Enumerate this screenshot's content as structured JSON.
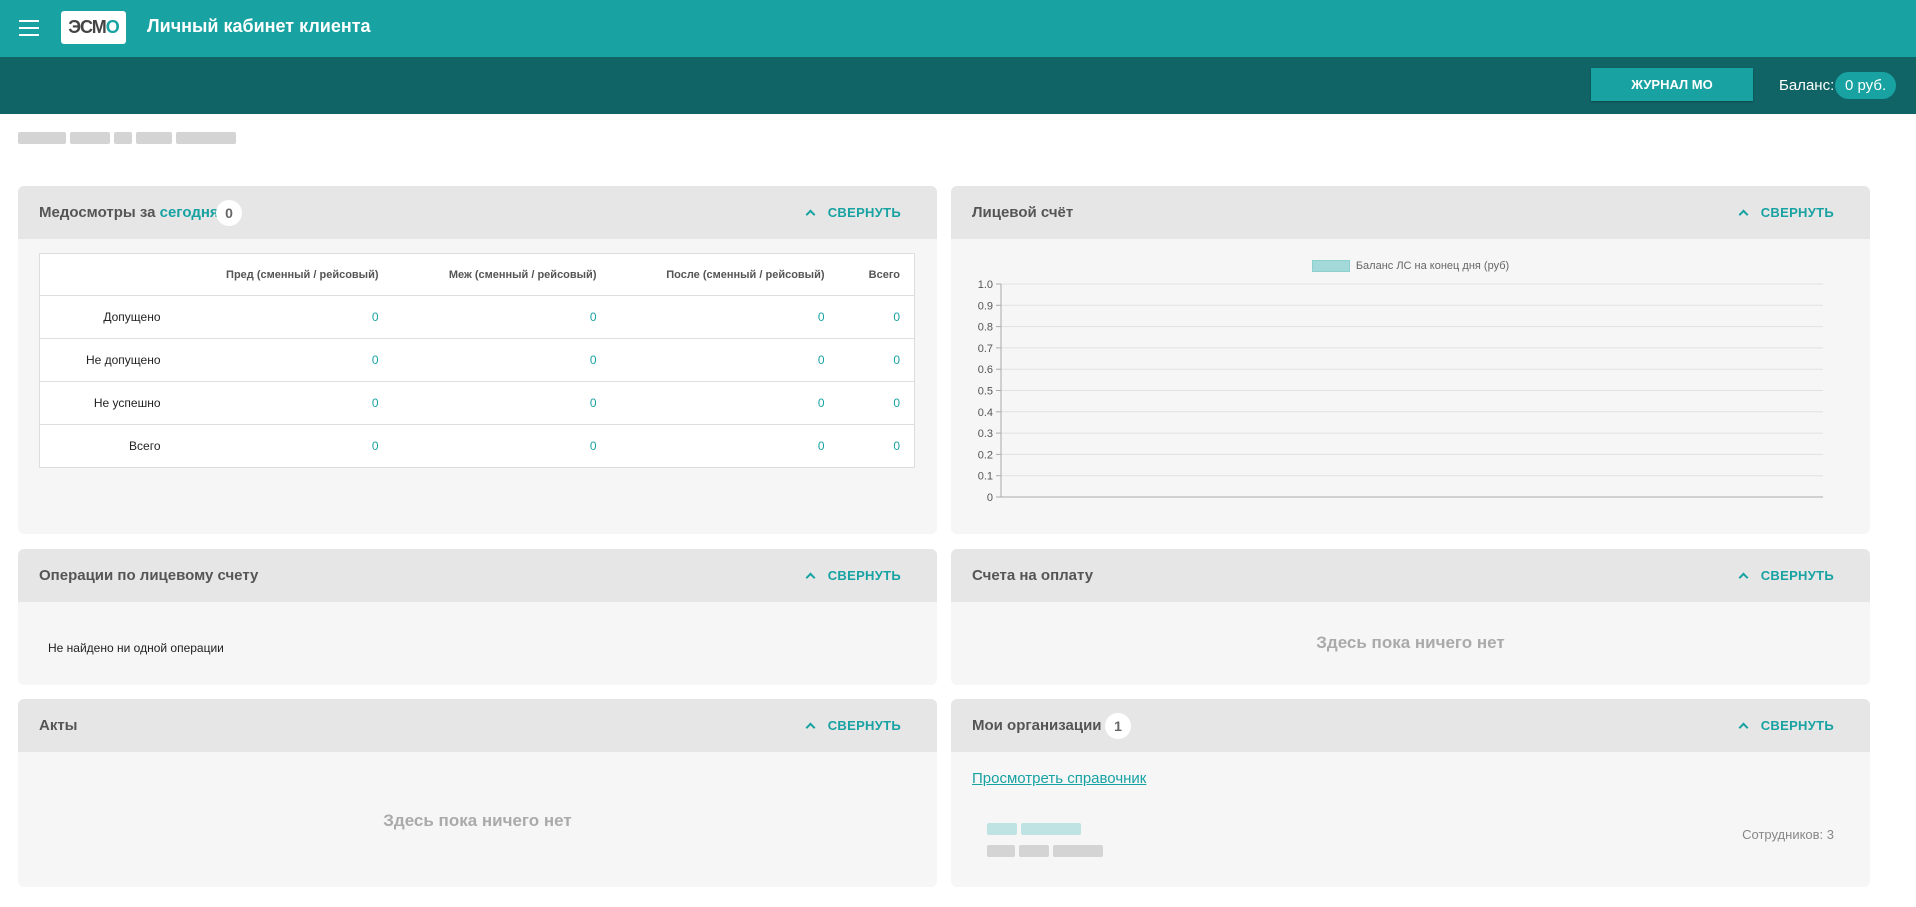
{
  "header": {
    "title": "Личный кабинет клиента",
    "logo_text_a": "ЭСМ",
    "logo_text_b": "О"
  },
  "subbar": {
    "journal_button": "ЖУРНАЛ МО",
    "balance_label": "Баланс:",
    "balance_value": "0 руб."
  },
  "colors": {
    "accent": "#18a2a2",
    "dark": "#116466"
  },
  "collapse_label": "СВЕРНУТЬ",
  "medosmotry": {
    "title_prefix": "Медосмотры за",
    "title_accent": "сегодня",
    "count": "0",
    "columns": [
      "Пред (сменный / рейсовый)",
      "Меж (сменный / рейсовый)",
      "После (сменный / рейсовый)",
      "Всего"
    ],
    "rows": [
      {
        "label": "Допущено",
        "values": [
          "0",
          "0",
          "0",
          "0"
        ]
      },
      {
        "label": "Не допущено",
        "values": [
          "0",
          "0",
          "0",
          "0"
        ]
      },
      {
        "label": "Не успешно",
        "values": [
          "0",
          "0",
          "0",
          "0"
        ]
      },
      {
        "label": "Всего",
        "values": [
          "0",
          "0",
          "0",
          "0"
        ]
      }
    ]
  },
  "account": {
    "title": "Лицевой счёт"
  },
  "chart_data": {
    "type": "line",
    "legend": [
      "Баланс ЛС на конец дня (руб)"
    ],
    "series": [
      {
        "name": "Баланс ЛС на конец дня (руб)",
        "values": []
      }
    ],
    "y_ticks": [
      "1.0",
      "0.9",
      "0.8",
      "0.7",
      "0.6",
      "0.5",
      "0.4",
      "0.3",
      "0.2",
      "0.1",
      "0"
    ],
    "ylim": [
      0,
      1
    ],
    "grid": true,
    "legend_position": "top"
  },
  "operations": {
    "title": "Операции по лицевому счету",
    "empty": "Не найдено ни одной операции"
  },
  "invoices": {
    "title": "Счета на оплату",
    "empty": "Здесь пока ничего нет"
  },
  "acts": {
    "title": "Акты",
    "empty": "Здесь пока ничего нет"
  },
  "orgs": {
    "title": "Мои организации",
    "count": "1",
    "link": "Просмотреть справочник",
    "staff": "Сотрудников: 3"
  }
}
